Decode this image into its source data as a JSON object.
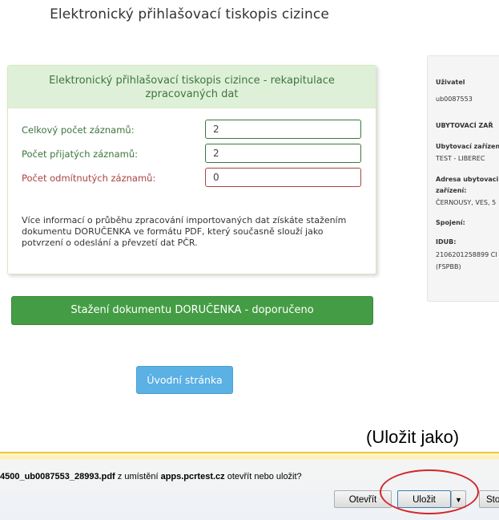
{
  "page_title": "Elektronický přihlašovací tiskopis cizince",
  "panel": {
    "heading": "Elektronický přihlašovací tiskopis cizince - rekapitulace zpracovaných dat",
    "rows": [
      {
        "label": "Celkový počet záznamů:",
        "value": "2"
      },
      {
        "label": "Počet přijatých záznamů:",
        "value": "2"
      },
      {
        "label": "Počet odmítnutých záznamů:",
        "value": "0"
      }
    ],
    "info": "Více informací o průběhu zpracování importovaných dat získáte stažením dokumentu DORUČENKA ve formátu PDF, který současně slouží jako potvrzení o odeslání a převzetí dat PČR."
  },
  "buttons": {
    "download": "Stažení dokumentu DORUČENKA - doporučeno",
    "home": "Úvodní stránka"
  },
  "sidebar": {
    "user_label": "Uživatel",
    "user_value": "ub0087553",
    "section": "UBYTOVACÍ ZAŘ",
    "facility_label": "Ubytovací zařízen",
    "facility_value": "TEST - LIBEREC",
    "address_label_1": "Adresa ubytovaci",
    "address_label_2": "zařízení:",
    "address_value": "ČERNOUSY, VES, 5",
    "contact_label": "Spojení:",
    "idub_label": "IDUB:",
    "idub_value_1": "2106201258899 CI",
    "idub_value_2": "(FSPBB)"
  },
  "annotation": "(Uložit jako)",
  "download_bar": {
    "file": "4500_ub0087553_28993.pdf",
    "from_text": " z umístění ",
    "site": "apps.pcrtest.cz",
    "question": " otevřít nebo uložit?",
    "open": "Otevřít",
    "save": "Uložit",
    "dropdown_icon": "▼",
    "cancel": "Sto"
  }
}
